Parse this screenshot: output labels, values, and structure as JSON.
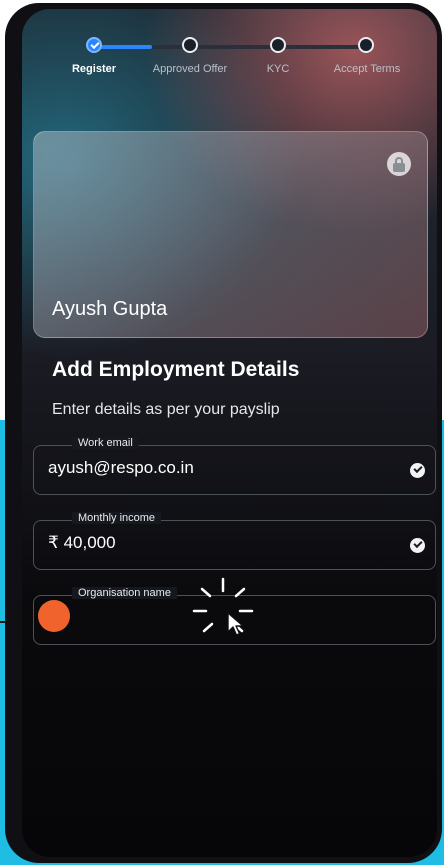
{
  "stepper": {
    "steps": [
      {
        "label": "Register",
        "state": "complete"
      },
      {
        "label": "Approved Offer",
        "state": "pending"
      },
      {
        "label": "KYC",
        "state": "pending"
      },
      {
        "label": "Accept Terms",
        "state": "pending"
      }
    ]
  },
  "card": {
    "name": "Ayush Gupta",
    "icon": "lock-icon"
  },
  "section": {
    "title": "Add Employment Details",
    "subtitle": "Enter details as per your payslip"
  },
  "form": {
    "work_email": {
      "label": "Work email",
      "value": "ayush@respo.co.in",
      "status_icon": "check-circle-icon"
    },
    "monthly_income": {
      "label": "Monthly income",
      "currency": "₹",
      "value": "40,000",
      "status_icon": "check-circle-icon"
    },
    "organisation": {
      "label": "Organisation name",
      "value": ""
    }
  },
  "colors": {
    "accent": "#2a86ff",
    "tap_indicator": "#f0632c",
    "backdrop": "#1fbde3"
  }
}
